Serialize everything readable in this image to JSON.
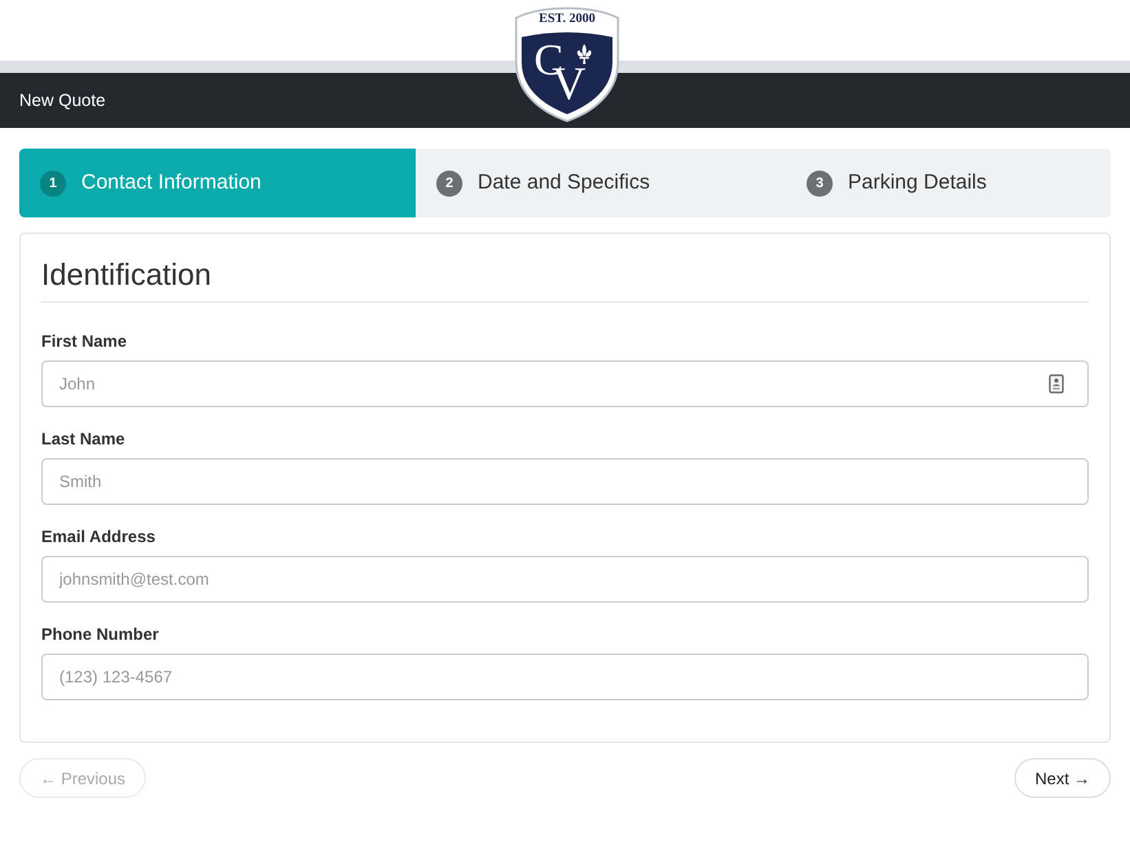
{
  "logo": {
    "tagline": "EST. 2000",
    "monogram": "CV"
  },
  "header": {
    "title": "New Quote"
  },
  "steps": [
    {
      "number": "1",
      "label": "Contact Information",
      "selected": true
    },
    {
      "number": "2",
      "label": "Date and Specifics",
      "selected": false
    },
    {
      "number": "3",
      "label": "Parking Details",
      "selected": false
    }
  ],
  "form": {
    "heading": "Identification",
    "fields": [
      {
        "label": "First Name",
        "placeholder": "John",
        "autofill": true
      },
      {
        "label": "Last Name",
        "placeholder": "Smith",
        "autofill": false
      },
      {
        "label": "Email Address",
        "placeholder": "johnsmith@test.com",
        "autofill": false
      },
      {
        "label": "Phone Number",
        "placeholder": "(123) 123-4567",
        "autofill": false
      }
    ]
  },
  "navigation": [
    {
      "label": "← Previous",
      "disabled": true
    },
    {
      "label": "Next →",
      "disabled": false
    }
  ]
}
